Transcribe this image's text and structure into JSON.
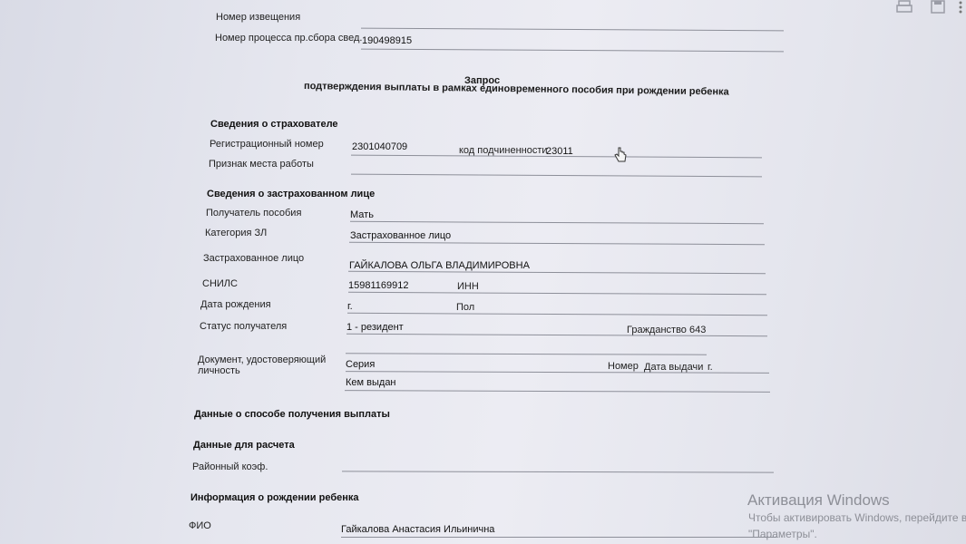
{
  "header": {
    "notice_number_label": "Номер извещения",
    "process_number_label": "Номер процесса пр.сбора свед.",
    "process_number_value": "190498915"
  },
  "document_title": {
    "line1": "Запрос",
    "line2": "подтверждения выплаты в рамках единовременного пособия при рождении ребенка"
  },
  "insurer": {
    "section_title": "Сведения о страхователе",
    "reg_number_label": "Регистрационный номер",
    "reg_number_value": "2301040709",
    "subordination_label": "код подчиненности",
    "subordination_value": "23011",
    "workplace_label": "Признак места работы"
  },
  "insured": {
    "section_title": "Сведения о застрахованном лице",
    "recipient_label": "Получатель пособия",
    "recipient_value": "Мать",
    "category_label": "Категория ЗЛ",
    "category_value": "Застрахованное лицо",
    "person_label": "Застрахованное лицо",
    "person_value": "ГАЙКАЛОВА ОЛЬГА ВЛАДИМИРОВНА",
    "snils_label": "СНИЛС",
    "snils_value": "15981169912",
    "inn_label": "ИНН",
    "birthdate_label": "Дата рождения",
    "birthdate_value": "г.",
    "sex_label": "Пол",
    "status_label": "Статус получателя",
    "status_value": "1 - резидент",
    "citizenship_label": "Гражданство 643",
    "id_doc_label_1": "Документ, удостоверяющий",
    "id_doc_label_2": "личность",
    "series_label": "Серия",
    "number_label": "Номер",
    "issue_date_label": "Дата выдачи",
    "issue_date_suffix": "г.",
    "issued_by_label": "Кем выдан"
  },
  "payment": {
    "section_title": "Данные о способе получения выплаты"
  },
  "calc": {
    "section_title": "Данные для расчета",
    "regional_coef_label": "Районный коэф."
  },
  "child": {
    "section_title": "Информация о рождении ребенка",
    "fio_label": "ФИО",
    "fio_value": "Гайкалова Анастасия Ильинична"
  },
  "watermark": {
    "title": "Активация Windows",
    "line1": "Чтобы активировать Windows, перейдите в",
    "line2": "\"Параметры\"."
  },
  "icons": [
    "printer-icon",
    "save-icon",
    "more-icon",
    "hand-cursor-icon"
  ]
}
